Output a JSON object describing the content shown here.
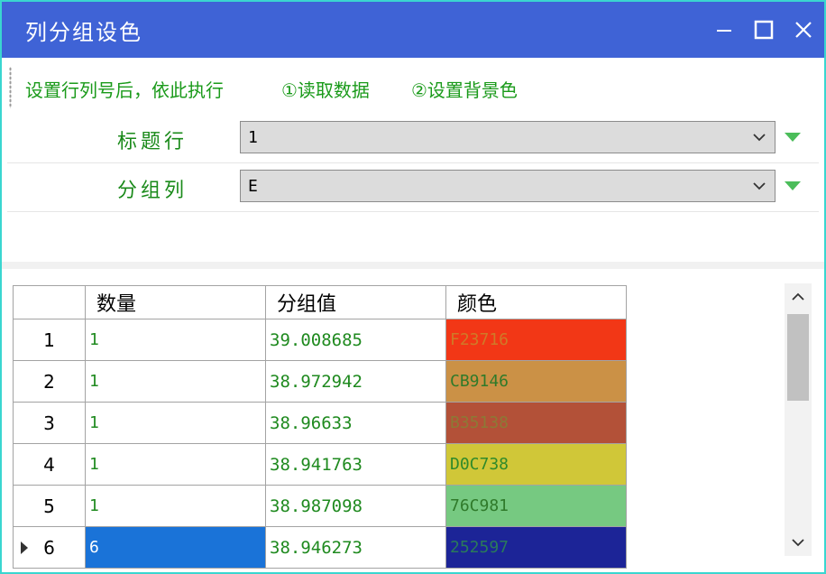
{
  "window": {
    "title": "列分组设色",
    "minimize_glyph": "–",
    "maximize_glyph": "☐",
    "close_glyph": "✕"
  },
  "toolbar": {
    "hint": "设置行列号后，依此执行",
    "read_button": "①读取数据",
    "color_button": "②设置背景色"
  },
  "form": {
    "title_row_label": "标题行",
    "title_row_value": "1",
    "group_col_label": "分组列",
    "group_col_value": "E"
  },
  "grid": {
    "columns": [
      "",
      "数量",
      "分组值",
      "颜色"
    ],
    "rows": [
      {
        "index": "1",
        "count": "1",
        "group_value": "39.008685",
        "color_code": "F23716",
        "bg": "#f23716",
        "fg": "#d07a28",
        "current": false
      },
      {
        "index": "2",
        "count": "1",
        "group_value": "38.972942",
        "color_code": "CB9146",
        "bg": "#cb9146",
        "fg": "#2f7a2a",
        "current": false
      },
      {
        "index": "3",
        "count": "1",
        "group_value": "38.96633",
        "color_code": "B35138",
        "bg": "#b35138",
        "fg": "#8c7a36",
        "current": false
      },
      {
        "index": "4",
        "count": "1",
        "group_value": "38.941763",
        "color_code": "D0C738",
        "bg": "#d0c738",
        "fg": "#2f8a2a",
        "current": false
      },
      {
        "index": "5",
        "count": "1",
        "group_value": "38.987098",
        "color_code": "76C981",
        "bg": "#76c981",
        "fg": "#2f7a2a",
        "current": false
      },
      {
        "index": "6",
        "count": "6",
        "group_value": "38.946273",
        "color_code": "252597",
        "bg": "#1c2497",
        "fg": "#2a7a5a",
        "current": true
      }
    ]
  },
  "colors": {
    "titlebar": "#3f63d6",
    "accent_green": "#1a9a1a",
    "selection_blue": "#1a73d8",
    "frame_border": "#3ad6d0"
  }
}
